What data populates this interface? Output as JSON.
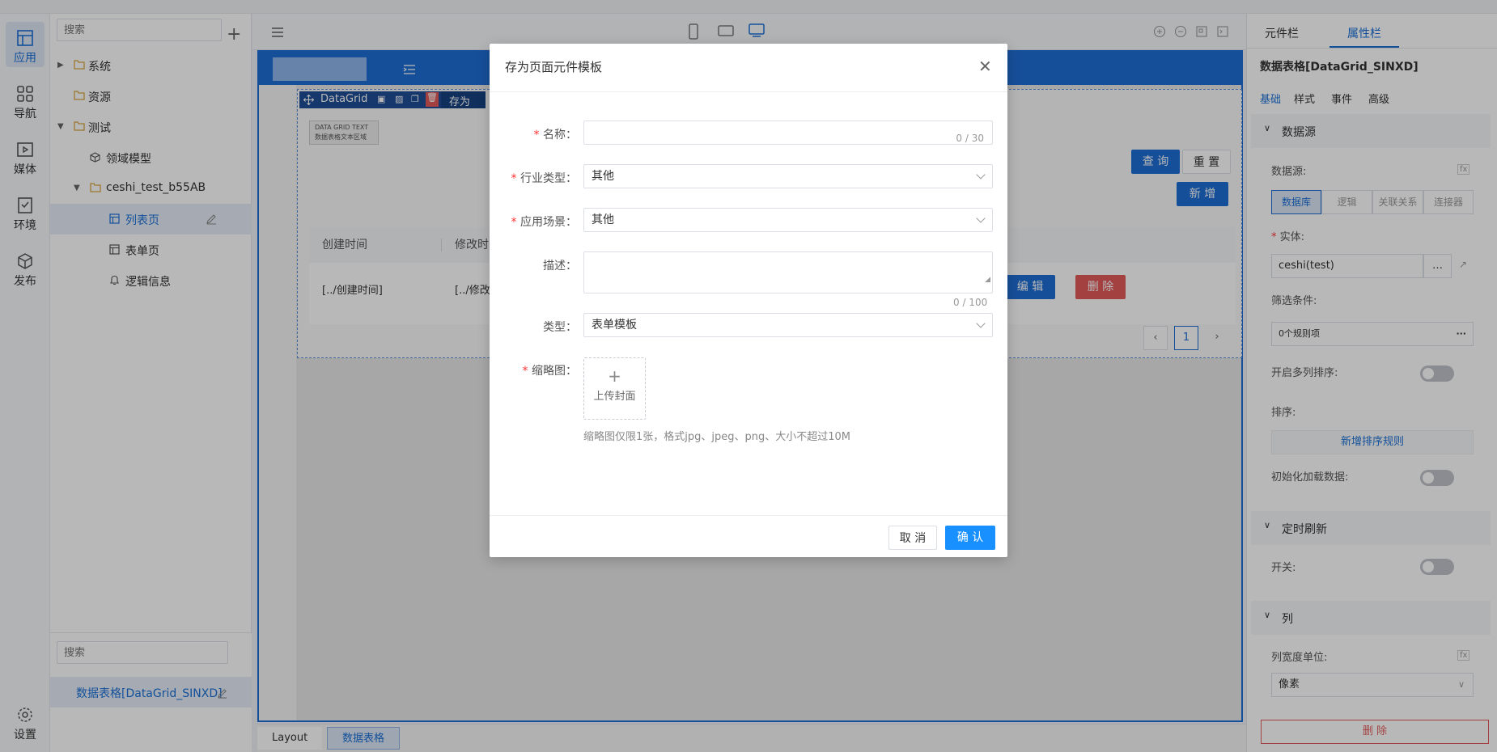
{
  "rail": {
    "items": [
      {
        "label": "应用"
      },
      {
        "label": "导航"
      },
      {
        "label": "媒体"
      },
      {
        "label": "环境"
      },
      {
        "label": "发布"
      }
    ],
    "settings": "设置"
  },
  "tree": {
    "search_placeholder": "搜索",
    "nodes": [
      "系统",
      "资源",
      "测试",
      "领域模型",
      "ceshi_test_b55AB",
      "列表页",
      "表单页",
      "逻辑信息"
    ],
    "component_search_placeholder": "搜索",
    "component_item": "数据表格[DataGrid_SINXD]"
  },
  "canvas": {
    "datagrid_bar": "DataGrid",
    "datagrid_bar_extra": "存为",
    "text_area_line1": "DATA GRID TEXT",
    "text_area_line2": "数据表格文本区域",
    "query": "查 询",
    "reset": "重 置",
    "add": "新 增",
    "col_created": "创建时间",
    "col_modified": "修改时",
    "cell_created": "[../创建时间]",
    "cell_modified": "[../修改",
    "edit": "编 辑",
    "delete": "删 除",
    "page": "1"
  },
  "breadcrumb": {
    "layout": "Layout",
    "current": "数据表格"
  },
  "right": {
    "tabs": [
      "元件栏",
      "属性栏"
    ],
    "title": "数据表格[DataGrid_SINXD]",
    "subtabs": [
      "基础",
      "样式",
      "事件",
      "高级"
    ],
    "section_datasource": "数据源",
    "datasource_label": "数据源:",
    "seg": [
      "数据库",
      "逻辑",
      "关联关系",
      "连接器"
    ],
    "entity_label": "实体:",
    "entity_value": "ceshi(test)",
    "filter_label": "筛选条件:",
    "filter_value": "0个规则项",
    "multisort_label": "开启多列排序:",
    "sort_label": "排序:",
    "add_sort": "新增排序规则",
    "init_load_label": "初始化加载数据:",
    "section_timer": "定时刷新",
    "switch_label": "开关:",
    "section_columns": "列",
    "colwidth_label": "列宽度单位:",
    "colwidth_value": "像素",
    "delete_btn": "删 除"
  },
  "modal": {
    "title": "存为页面元件模板",
    "name_label": "名称",
    "name_count": "0 / 30",
    "industry_label": "行业类型",
    "industry_value": "其他",
    "scene_label": "应用场景",
    "scene_value": "其他",
    "desc_label": "描述",
    "desc_count": "0 / 100",
    "type_label": "类型",
    "type_value": "表单模板",
    "thumb_label": "缩略图",
    "upload_plus": "+",
    "upload_text": "上传封面",
    "hint": "缩略图仅限1张，格式jpg、jpeg、png、大小不超过10M",
    "cancel": "取 消",
    "confirm": "确 认"
  },
  "colors": {
    "primary": "#1f6ed4",
    "confirm": "#1890ff",
    "danger": "#e25a5a"
  }
}
